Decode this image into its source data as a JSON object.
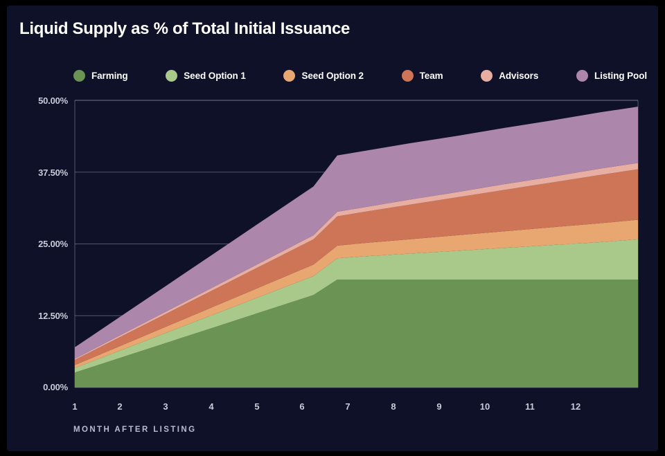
{
  "card": {
    "background": "#0e1128",
    "page_background": "#000000"
  },
  "header": {
    "title": "Liquid Supply as % of Total Initial Issuance"
  },
  "legend": {
    "position": "top",
    "items": [
      {
        "label": "Farming",
        "color": "#6b9353"
      },
      {
        "label": "Seed Option 1",
        "color": "#a8c98a"
      },
      {
        "label": "Seed Option 2",
        "color": "#e8a771"
      },
      {
        "label": "Team",
        "color": "#cd7556"
      },
      {
        "label": "Advisors",
        "color": "#e8aea1"
      },
      {
        "label": "Listing Pool",
        "color": "#ad86ab"
      }
    ]
  },
  "axes": {
    "y_ticks": [
      "0.00%",
      "12.50%",
      "25.00%",
      "37.50%",
      "50.00%"
    ],
    "x_ticks": [
      "1",
      "2",
      "3",
      "4",
      "5",
      "6",
      "7",
      "8",
      "9",
      "10",
      "11",
      "12"
    ],
    "x_title": "MONTH AFTER LISTING",
    "grid_color": "#8c90a8",
    "tick_color": "#c9cbda"
  },
  "chart_data": {
    "type": "area",
    "stacked": true,
    "title": "Liquid Supply as % of Total Initial Issuance",
    "xlabel": "MONTH AFTER LISTING",
    "ylabel": "",
    "ylim": [
      0,
      50
    ],
    "xlim": [
      1,
      12.8
    ],
    "grid": true,
    "legend_position": "top",
    "x": [
      1,
      2,
      3,
      4,
      5,
      6,
      6.5,
      7,
      8,
      9,
      10,
      11,
      12,
      12.8
    ],
    "series": [
      {
        "name": "Farming",
        "color": "#6b9353",
        "values": [
          2.6,
          5.3,
          8.0,
          10.7,
          13.4,
          16.1,
          18.8,
          18.8,
          18.8,
          18.8,
          18.8,
          18.8,
          18.8,
          18.8
        ]
      },
      {
        "name": "Seed Option 1",
        "color": "#a8c98a",
        "values": [
          0.8,
          1.3,
          1.8,
          2.3,
          2.8,
          3.3,
          3.7,
          4.0,
          4.5,
          5.0,
          5.5,
          6.0,
          6.5,
          7.0
        ]
      },
      {
        "name": "Seed Option 2",
        "color": "#e8a771",
        "values": [
          0.5,
          0.8,
          1.1,
          1.4,
          1.7,
          2.0,
          2.2,
          2.3,
          2.5,
          2.7,
          2.9,
          3.1,
          3.3,
          3.4
        ]
      },
      {
        "name": "Team",
        "color": "#cd7556",
        "values": [
          0.9,
          1.6,
          2.3,
          3.0,
          3.7,
          4.4,
          5.1,
          5.4,
          6.0,
          6.6,
          7.2,
          7.8,
          8.4,
          8.8
        ]
      },
      {
        "name": "Advisors",
        "color": "#e8aea1",
        "values": [
          0.2,
          0.3,
          0.4,
          0.5,
          0.6,
          0.7,
          0.8,
          0.8,
          0.9,
          0.9,
          1.0,
          1.0,
          1.1,
          1.1
        ]
      },
      {
        "name": "Listing Pool",
        "color": "#ad86ab",
        "values": [
          2.0,
          3.3,
          4.6,
          5.9,
          7.2,
          8.5,
          9.8,
          9.8,
          9.8,
          9.8,
          9.8,
          9.8,
          9.8,
          9.8
        ]
      }
    ],
    "totals": [
      7.0,
      12.6,
      18.2,
      23.8,
      29.4,
      35.0,
      40.4,
      41.1,
      42.5,
      43.8,
      45.2,
      46.5,
      47.9,
      48.9
    ]
  }
}
